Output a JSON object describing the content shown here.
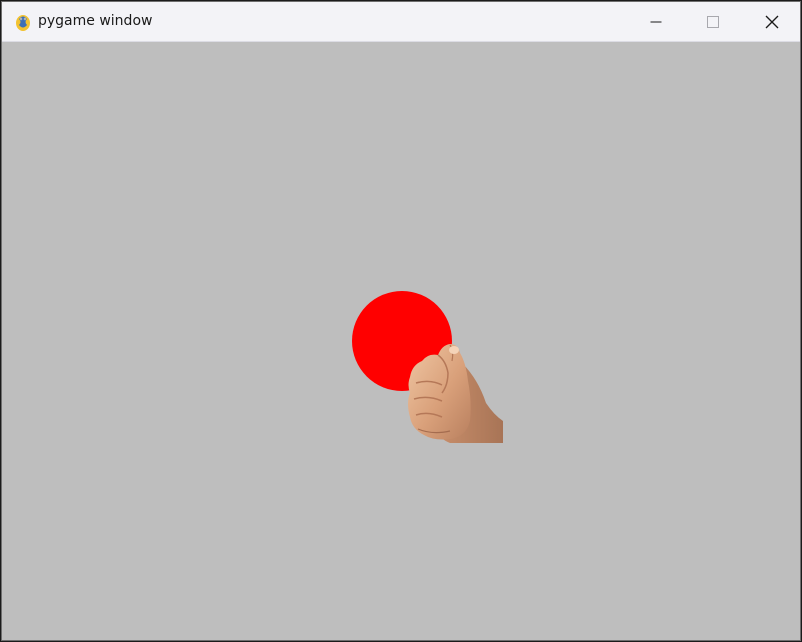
{
  "window": {
    "title": "pygame window",
    "app_icon": "pygame-snake-icon",
    "controls": [
      "minimize-icon",
      "maximize-icon",
      "close-icon"
    ]
  },
  "scene": {
    "background_color": "#bebebe",
    "ball_color": "#ff0000",
    "hand_sprite": "fist-image"
  }
}
